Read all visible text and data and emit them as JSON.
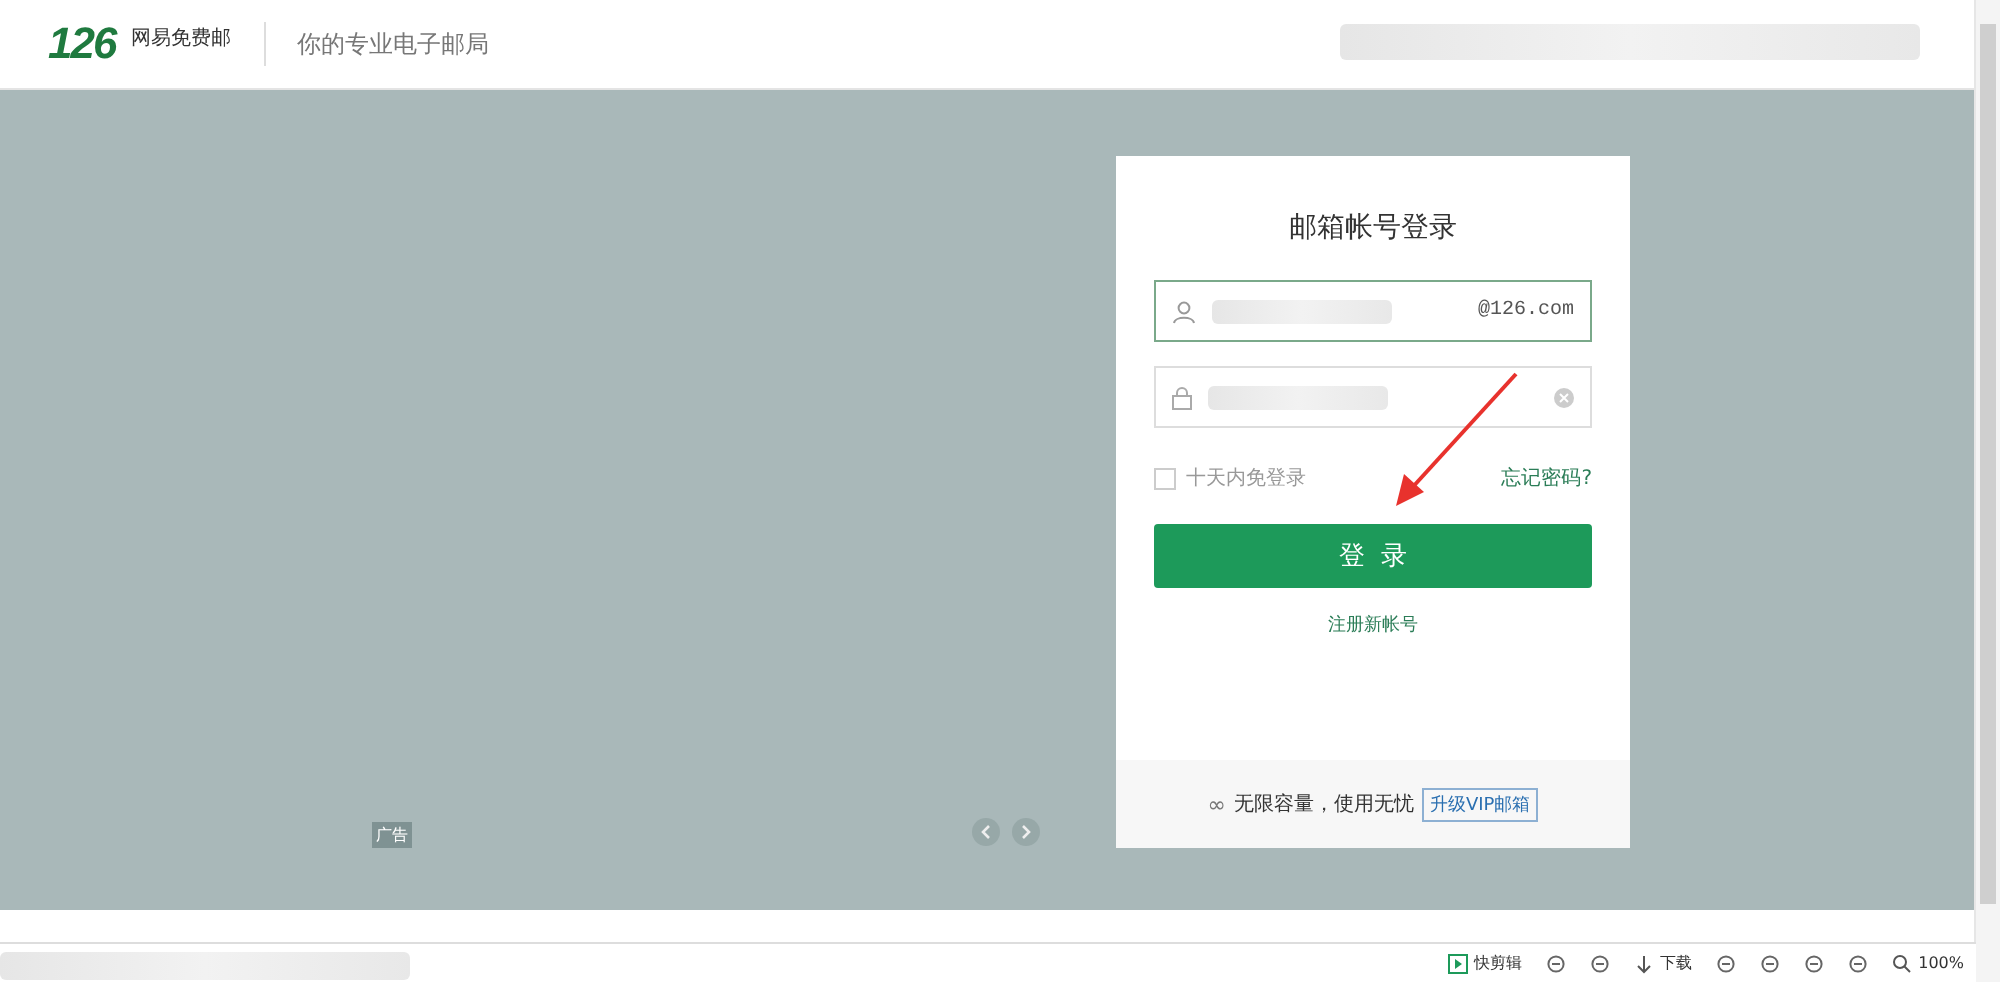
{
  "header": {
    "logo": "126",
    "brand": "网易免费邮",
    "slogan": "你的专业电子邮局"
  },
  "banner": {
    "ad_label": "广告"
  },
  "login": {
    "title": "邮箱帐号登录",
    "username": {
      "suffix": "@126.com"
    },
    "remember": {
      "label": "十天内免登录",
      "checked": false
    },
    "forgot": "忘记密码?",
    "submit": "登  录",
    "register": "注册新帐号",
    "promo": {
      "icon": "∞",
      "text": "无限容量，使用无忧",
      "link": "升级VIP邮箱"
    }
  },
  "status_bar": {
    "items": [
      {
        "kind": "app",
        "label": "快剪辑"
      },
      {
        "kind": "icon"
      },
      {
        "kind": "icon"
      },
      {
        "kind": "download",
        "label": "下载"
      },
      {
        "kind": "icon"
      },
      {
        "kind": "icon"
      },
      {
        "kind": "icon"
      },
      {
        "kind": "icon"
      },
      {
        "kind": "zoom",
        "label": "100%"
      }
    ]
  }
}
